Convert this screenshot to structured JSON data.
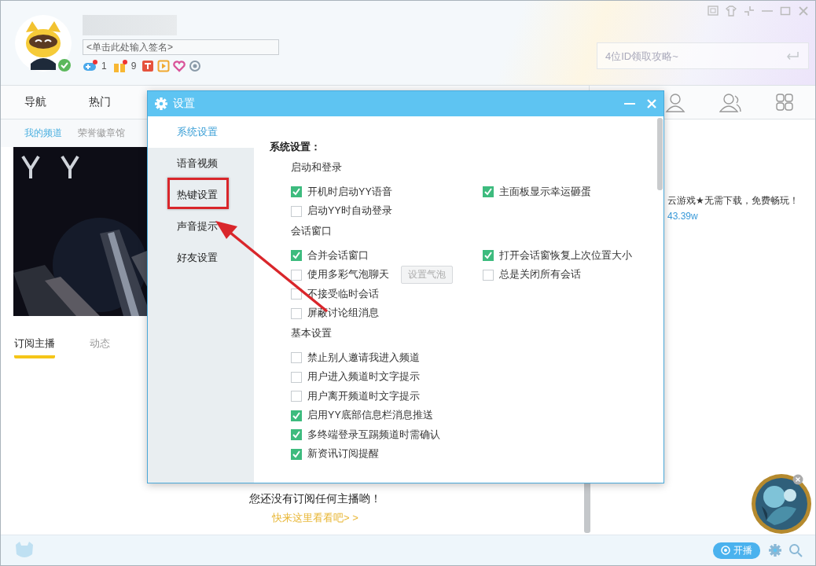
{
  "header": {
    "signature_placeholder": "<单击此处输入签名>",
    "badge_counts": [
      "1",
      "9"
    ],
    "search_placeholder": "4位ID领取攻略~"
  },
  "nav": [
    {
      "label": "导航"
    },
    {
      "label": "热门"
    }
  ],
  "subtabs": [
    {
      "label": "我的频道",
      "selected": true
    },
    {
      "label": "荣誉徽章馆",
      "selected": false
    }
  ],
  "tabs": [
    {
      "label": "订阅主播",
      "selected": true
    },
    {
      "label": "动态",
      "selected": false
    }
  ],
  "empty_state": {
    "message": "您还没有订阅任何主播哟！",
    "link": "快来这里看看吧> >"
  },
  "promo": {
    "text": "云游戏★无需下载，免费畅玩！",
    "count": "43.39w"
  },
  "live_button": "开播",
  "dialog": {
    "title": "设置",
    "nav": [
      {
        "label": "系统设置",
        "selected": true
      },
      {
        "label": "语音视频",
        "selected": false
      },
      {
        "label": "热键设置",
        "selected": false
      },
      {
        "label": "声音提示",
        "selected": false
      },
      {
        "label": "好友设置",
        "selected": false
      }
    ],
    "heading": "系统设置：",
    "sections": [
      {
        "title": "启动和登录",
        "rows": [
          [
            {
              "label": "开机时启动YY语音",
              "checked": true
            },
            {
              "label": "主面板显示幸运砸蛋",
              "checked": true
            }
          ],
          [
            {
              "label": "启动YY时自动登录",
              "checked": false
            }
          ]
        ]
      },
      {
        "title": "会话窗口",
        "rows": [
          [
            {
              "label": "合并会话窗口",
              "checked": true
            },
            {
              "label": "打开会话窗恢复上次位置大小",
              "checked": true
            }
          ],
          [
            {
              "label": "使用多彩气泡聊天",
              "checked": false,
              "button": {
                "label": "设置气泡",
                "disabled": true
              }
            },
            {
              "label": "总是关闭所有会话",
              "checked": false
            }
          ],
          [
            {
              "label": "不接受临时会话",
              "checked": false
            }
          ],
          [
            {
              "label": "屏蔽讨论组消息",
              "checked": false
            }
          ]
        ]
      },
      {
        "title": "基本设置",
        "rows": [
          [
            {
              "label": "禁止别人邀请我进入频道",
              "checked": false
            }
          ],
          [
            {
              "label": "用户进入频道时文字提示",
              "checked": false
            }
          ],
          [
            {
              "label": "用户离开频道时文字提示",
              "checked": false
            }
          ],
          [
            {
              "label": "启用YY底部信息栏消息推送",
              "checked": true
            }
          ],
          [
            {
              "label": "多终端登录互踢频道时需确认",
              "checked": true
            }
          ],
          [
            {
              "label": "新资讯订阅提醒",
              "checked": true
            }
          ]
        ]
      }
    ]
  }
}
